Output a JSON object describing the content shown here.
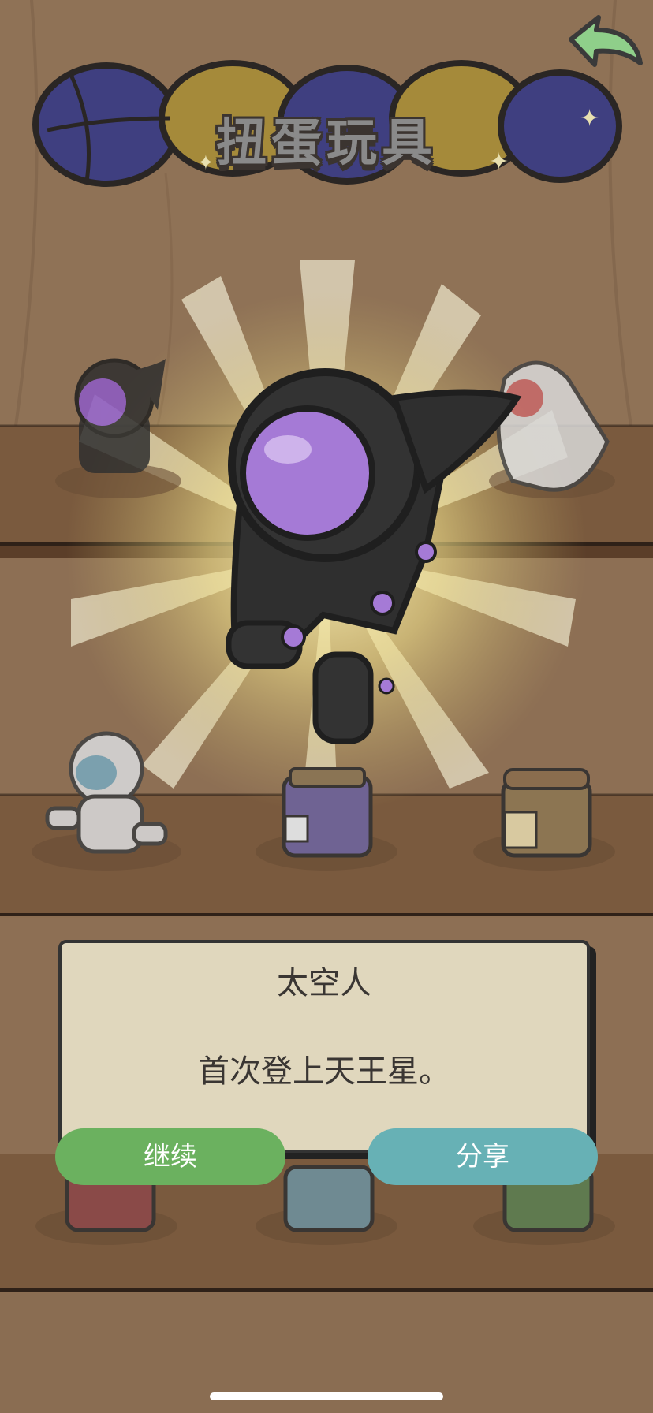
{
  "header": {
    "title": "扭蛋玩具",
    "back_icon": "back-arrow-icon"
  },
  "featured_toy": {
    "icon": "astronaut-figure",
    "helmet_color": "#a57ad6",
    "suit_color": "#333333"
  },
  "shelf": {
    "items": [
      {
        "icon": "dark-astronaut-toy"
      },
      {
        "icon": "white-rocket-toy"
      },
      {
        "icon": "white-robot-toy"
      },
      {
        "icon": "purple-jar"
      },
      {
        "icon": "orange-jar"
      },
      {
        "icon": "red-jar"
      },
      {
        "icon": "blue-jar"
      },
      {
        "icon": "green-jar"
      }
    ]
  },
  "dialog": {
    "name": "太空人",
    "description": "首次登上天王星。",
    "continue_label": "继续",
    "share_label": "分享"
  },
  "colors": {
    "continue": "#6bb15f",
    "share": "#67b1b5",
    "dialog_bg": "#e0d7bd"
  }
}
